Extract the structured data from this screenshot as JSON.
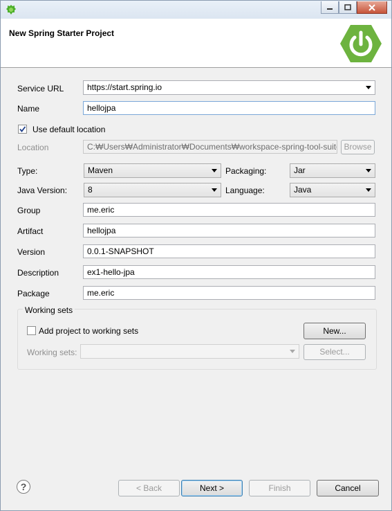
{
  "window": {
    "title": "New Spring Starter Project"
  },
  "form": {
    "service_url_label": "Service URL",
    "service_url_value": "https://start.spring.io",
    "name_label": "Name",
    "name_value": "hellojpa",
    "use_default_location_label": "Use default location",
    "use_default_location_checked": true,
    "location_label": "Location",
    "location_value": "C:₩Users₩Administrator₩Documents₩workspace-spring-tool-suite",
    "browse_label": "Browse",
    "type_label": "Type:",
    "type_value": "Maven",
    "packaging_label": "Packaging:",
    "packaging_value": "Jar",
    "java_version_label": "Java Version:",
    "java_version_value": "8",
    "language_label": "Language:",
    "language_value": "Java",
    "group_label": "Group",
    "group_value": "me.eric",
    "artifact_label": "Artifact",
    "artifact_value": "hellojpa",
    "version_label": "Version",
    "version_value": "0.0.1-SNAPSHOT",
    "description_label": "Description",
    "description_value": "ex1-hello-jpa",
    "package_label": "Package",
    "package_value": "me.eric"
  },
  "working_sets": {
    "group_title": "Working sets",
    "add_label": "Add project to working sets",
    "new_label": "New...",
    "sets_label": "Working sets:",
    "sets_value": "",
    "select_label": "Select..."
  },
  "footer": {
    "help_label": "?",
    "back_label": "< Back",
    "next_label": "Next >",
    "finish_label": "Finish",
    "cancel_label": "Cancel"
  },
  "colors": {
    "spring_green": "#6db33f"
  }
}
